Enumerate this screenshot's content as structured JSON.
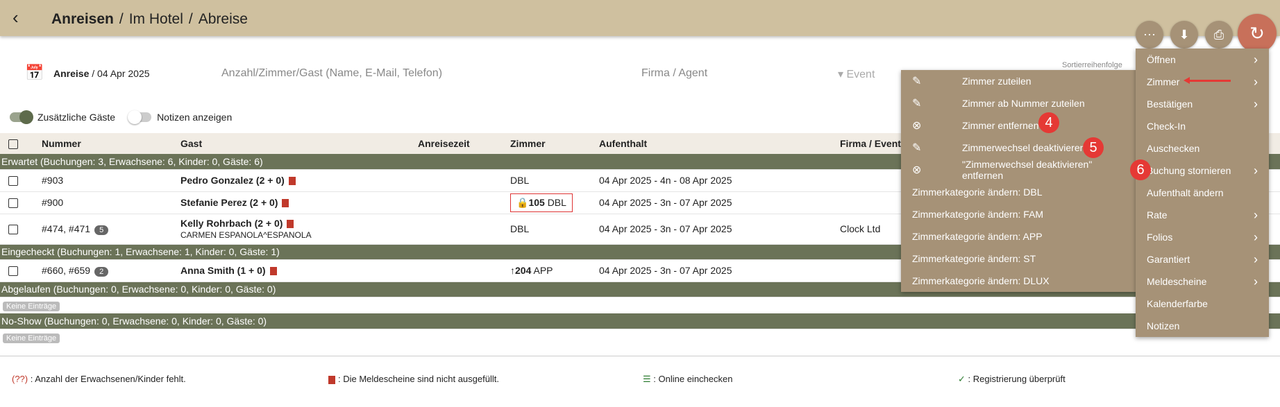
{
  "breadcrumb": {
    "a": "Anreisen",
    "b": "Im Hotel",
    "c": "Abreise",
    "sep": "/"
  },
  "toolbar": {
    "more": "⋯",
    "download": "⬇",
    "print": "⎙",
    "refresh": "↻"
  },
  "filters": {
    "anreise_label": "Anreise",
    "anreise_date": "04 Apr 2025",
    "search": "Anzahl/Zimmer/Gast (Name, E-Mail, Telefon)",
    "firma": "Firma / Agent",
    "event": "Event",
    "sort": "Sortierreihenfolge"
  },
  "toggles": {
    "extra": "Zusätzliche Gäste",
    "notes": "Notizen anzeigen"
  },
  "columns": [
    "Nummer",
    "Gast",
    "Anreisezeit",
    "Zimmer",
    "Aufenthalt",
    "Firma / Event, A"
  ],
  "groups": {
    "erwartet": "Erwartet (Buchungen: 3, Erwachsene: 6, Kinder: 0, Gäste: 6)",
    "eingecheckt": "Eingecheckt (Buchungen: 1, Erwachsene: 1, Kinder: 0, Gäste: 1)",
    "abgelaufen": "Abgelaufen (Buchungen: 0, Erwachsene: 0, Kinder: 0, Gäste: 0)",
    "noshow": "No-Show (Buchungen: 0, Erwachsene: 0, Kinder: 0, Gäste: 0)",
    "empty": "Keine Einträge"
  },
  "rows": [
    {
      "num": "#903",
      "guest": "Pedro Gonzalez (2 + 0)",
      "room": "DBL",
      "stay": "04 Apr 2025 - 4n - 08 Apr 2025"
    },
    {
      "num": "#900",
      "guest": "Stefanie Perez (2 + 0)",
      "room_no": "105",
      "room": "DBL",
      "stay": "04 Apr 2025 - 3n - 07 Apr 2025"
    },
    {
      "num": "#474, #471",
      "pill": "5",
      "guest": "Kelly Rohrbach (2 + 0)",
      "sub": "CARMEN ESPANOLA^ESPANOLA",
      "room": "DBL",
      "stay": "04 Apr 2025 - 3n - 07 Apr 2025",
      "firma": "Clock Ltd"
    },
    {
      "num": "#660, #659",
      "pill": "2",
      "guest": "Anna Smith (1 + 0)",
      "room_no": "204",
      "room": "APP",
      "stay": "04 Apr 2025 - 3n - 07 Apr 2025"
    }
  ],
  "menu": [
    "Öffnen",
    "Zimmer",
    "Bestätigen",
    "Check-In",
    "Auschecken",
    "Buchung stornieren",
    "Aufenthalt ändern",
    "Rate",
    "Folios",
    "Garantiert",
    "Meldescheine",
    "Kalenderfarbe",
    "Notizen"
  ],
  "submenu": [
    "Zimmer zuteilen",
    "Zimmer ab Nummer zuteilen",
    "Zimmer entfernen",
    "Zimmerwechsel deaktivieren",
    "\"Zimmerwechsel deaktivieren\" entfernen",
    "Zimmerkategorie ändern: DBL",
    "Zimmerkategorie ändern: FAM",
    "Zimmerkategorie ändern: APP",
    "Zimmerkategorie ändern: ST",
    "Zimmerkategorie ändern: DLUX"
  ],
  "badges": [
    "4",
    "5",
    "6"
  ],
  "legend": {
    "a_mark": "(??)",
    "a": ": Anzahl der Erwachsenen/Kinder fehlt.",
    "b": ": Die Meldescheine sind nicht ausgefüllt.",
    "c": ": Online einchecken",
    "d": ": Registrierung überprüft"
  }
}
